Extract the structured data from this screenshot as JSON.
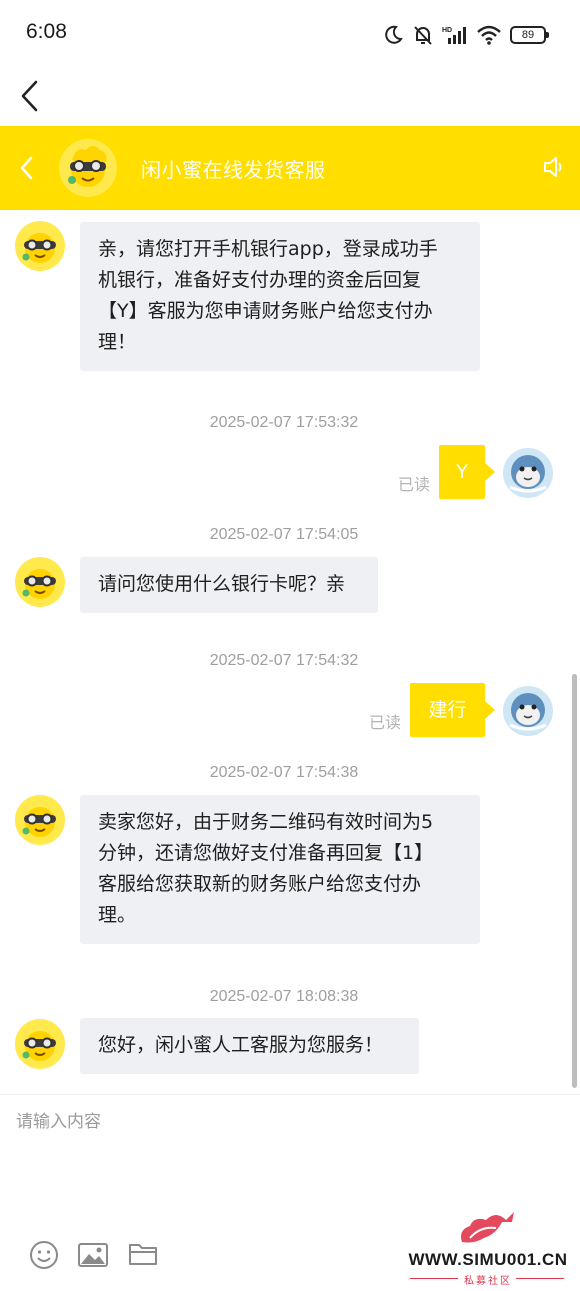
{
  "status_bar": {
    "time": "6:08",
    "battery": "89"
  },
  "header": {
    "title": "闲小蜜在线发货客服"
  },
  "messages": [
    {
      "lines": [
        "亲，请您打开手机银行app，登录成功手",
        "机银行，准备好支付办理的资金后回复",
        "【Y】客服为您申请财务账户给您支付办",
        "理！"
      ]
    },
    {
      "timestamp": "2025-02-07 17:53:32",
      "text": "Y",
      "status": "已读"
    },
    {
      "timestamp": "2025-02-07 17:54:05",
      "text": "请问您使用什么银行卡呢？亲"
    },
    {
      "timestamp": "2025-02-07 17:54:32",
      "text": "建行",
      "status": "已读"
    },
    {
      "timestamp": "2025-02-07 17:54:38",
      "lines": [
        "卖家您好，由于财务二维码有效时间为5",
        "分钟，还请您做好支付准备再回复【1】",
        "客服给您获取新的财务账户给您支付办",
        "理。"
      ]
    },
    {
      "timestamp": "2025-02-07 18:08:38",
      "text": "您好，闲小蜜人工客服为您服务！"
    }
  ],
  "input": {
    "placeholder": "请输入内容"
  },
  "watermark": {
    "url": "WWW.SIMU001.CN",
    "subtitle": "私募社区"
  },
  "colors": {
    "brand_yellow": "#ffde00",
    "bubble_gray": "#eef0f3",
    "read_text": "#b4b4b4"
  }
}
